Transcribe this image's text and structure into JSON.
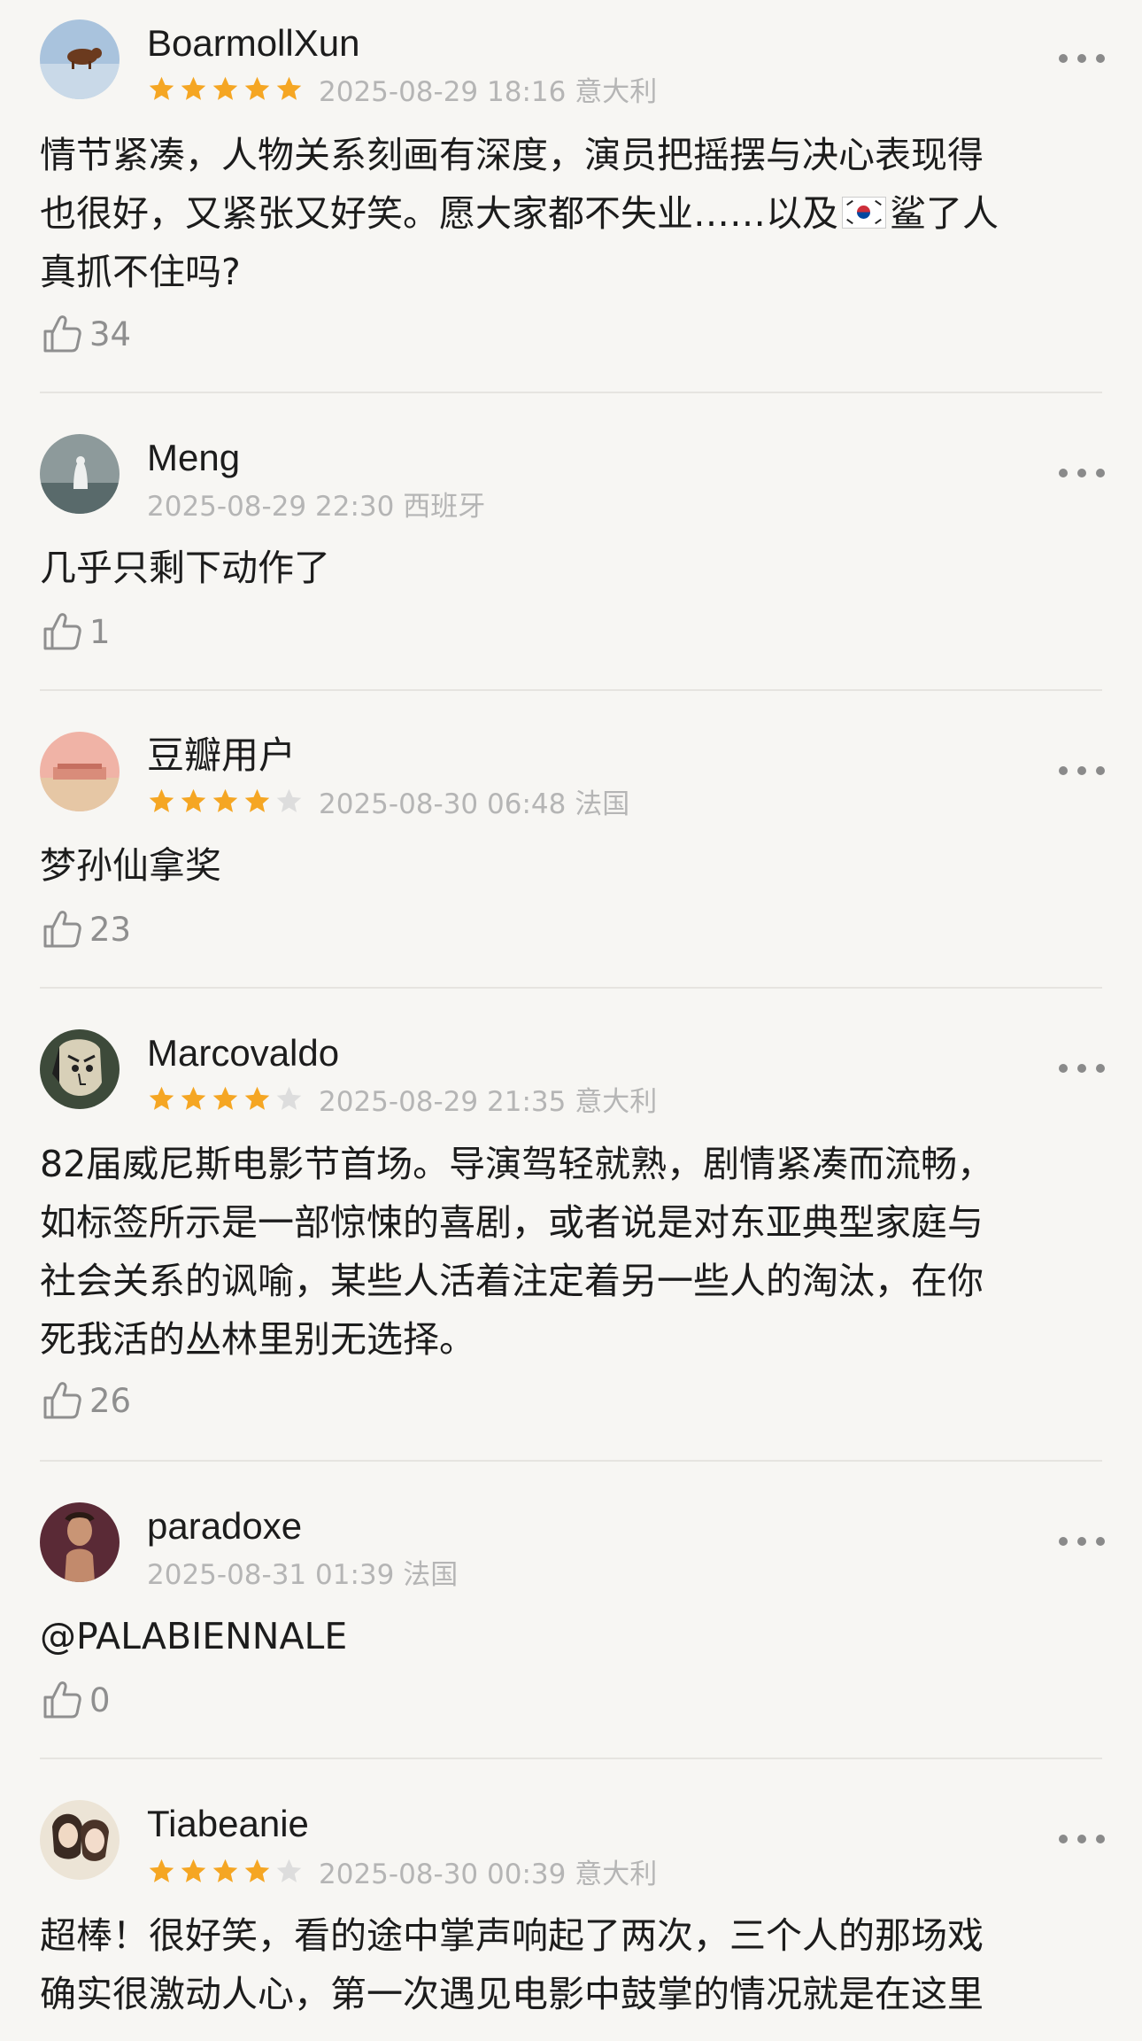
{
  "accent": {
    "star_filled": "#f5a623",
    "star_empty": "#dddddd"
  },
  "reviews": [
    {
      "username": "BoarmollXun",
      "rating": 5,
      "datetime": "2025-08-29 18:16",
      "location": "意大利",
      "lines": [
        "情节紧凑，人物关系刻画有深度，演员把摇摆与决心表现得",
        "也很好，又紧张又好笑。愿大家都不失业……以及",
        "鲨了人",
        "真抓不住吗?"
      ],
      "likes": "34"
    },
    {
      "username": "Meng",
      "rating": 0,
      "datetime": "2025-08-29 22:30",
      "location": "西班牙",
      "lines": [
        "几乎只剩下动作了"
      ],
      "likes": "1"
    },
    {
      "username": "豆瓣用户",
      "rating": 4,
      "datetime": "2025-08-30 06:48",
      "location": "法国",
      "lines": [
        "梦孙仙拿奖"
      ],
      "likes": "23"
    },
    {
      "username": "Marcovaldo",
      "rating": 4,
      "datetime": "2025-08-29 21:35",
      "location": "意大利",
      "lines": [
        "82届威尼斯电影节首场。导演驾轻就熟，剧情紧凑而流畅，",
        "如标签所示是一部惊悚的喜剧，或者说是对东亚典型家庭与",
        "社会关系的讽喻，某些人活着注定着另一些人的淘汰，在你",
        "死我活的丛林里别无选择。"
      ],
      "likes": "26"
    },
    {
      "username": "paradoxe",
      "rating": 0,
      "datetime": "2025-08-31 01:39",
      "location": "法国",
      "lines": [
        "@PALABIENNALE"
      ],
      "likes": "0"
    },
    {
      "username": "Tiabeanie",
      "rating": 4,
      "datetime": "2025-08-30 00:39",
      "location": "意大利",
      "lines": [
        "超棒！很好笑，看的途中掌声响起了两次，三个人的那场戏",
        "确实很激动人心，第一次遇见电影中鼓掌的情况就是在这里"
      ],
      "likes": ""
    }
  ]
}
